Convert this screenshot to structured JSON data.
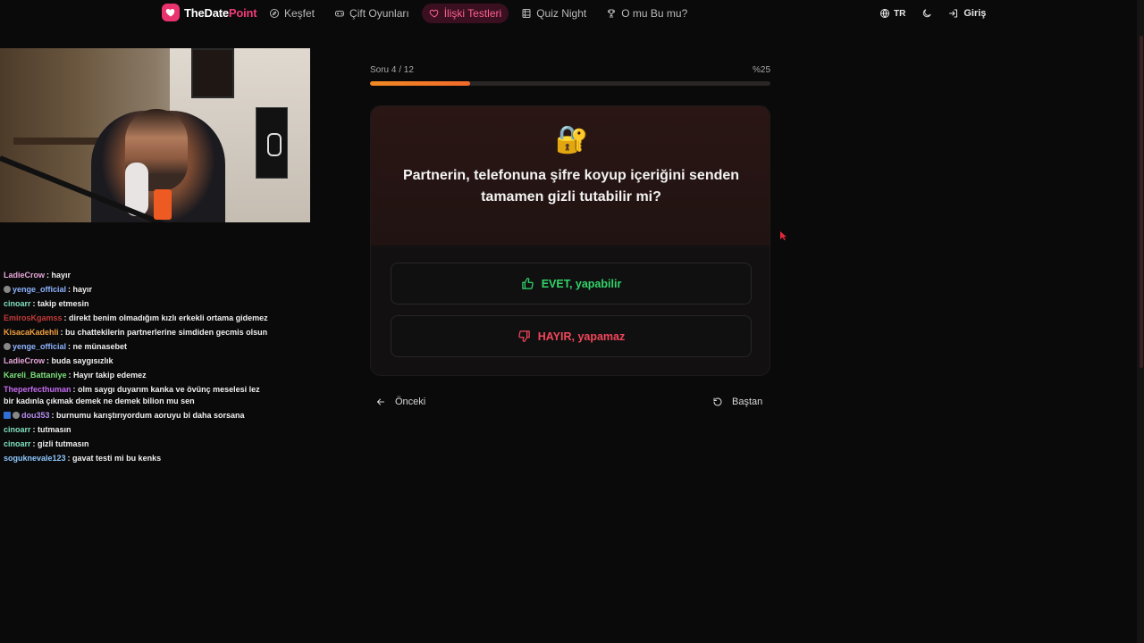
{
  "nav": {
    "brand_part1": "TheDate",
    "brand_part2": "Point",
    "links": [
      {
        "label": "Keşfet",
        "icon": "compass-icon"
      },
      {
        "label": "Çift Oyunları",
        "icon": "gamepad-icon"
      },
      {
        "label": "İlişki Testleri",
        "icon": "heart-icon",
        "active": true
      },
      {
        "label": "Quiz Night",
        "icon": "film-icon"
      },
      {
        "label": "O mu Bu mu?",
        "icon": "trophy-icon"
      }
    ],
    "language": "TR",
    "login": "Giriş"
  },
  "quiz": {
    "progress_label": "Soru 4 / 12",
    "progress_percent_label": "%25",
    "progress": 0.25,
    "question_icon": "lock-key-icon",
    "question": "Partnerin, telefonuna şifre koyup içeriğini senden tamamen gizli tutabilir mi?",
    "answer_yes": "EVET, yapabilir",
    "answer_no": "HAYIR, yapamaz",
    "prev_label": "Önceki",
    "restart_label": "Baştan"
  },
  "chat": [
    {
      "user": "LadieCrow",
      "color": "#e6a6d8",
      "text": ": hayır"
    },
    {
      "user": "yenge_official",
      "color": "#8cb4ff",
      "text": ": hayır",
      "badge": true
    },
    {
      "user": "cinoarr",
      "color": "#7fe0c0",
      "text": ": takip etmesin"
    },
    {
      "user": "EmirosKgamss",
      "color": "#c23a3a",
      "text": ": direkt benim olmadığım kızlı erkekli ortama gidemez"
    },
    {
      "user": "KisacaKadehli",
      "color": "#f0a040",
      "text": ": bu chattekilerin partnerlerine simdiden gecmis olsun"
    },
    {
      "user": "yenge_official",
      "color": "#8cb4ff",
      "text": ": ne münasebet",
      "badge": true
    },
    {
      "user": "LadieCrow",
      "color": "#e6a6d8",
      "text": ": buda saygısızlık"
    },
    {
      "user": "Kareli_Battaniye",
      "color": "#7be07b",
      "text": ": Hayır takip edemez"
    },
    {
      "user": "Theperfecthuman",
      "color": "#c46cf0",
      "text": ": olm saygı duyarım kanka ve övünç meselesi lez bir kadınla çıkmak demek ne demek bilion mu sen"
    },
    {
      "user": "dou353",
      "color": "#b48cf0",
      "text": ": burnumu karıştırıyordum aoruyu bi daha sorsana",
      "badge2": true
    },
    {
      "user": "cinoarr",
      "color": "#7fe0c0",
      "text": ": tutmasın"
    },
    {
      "user": "cinoarr",
      "color": "#7fe0c0",
      "text": ": gizli tutmasın"
    },
    {
      "user": "soguknevale123",
      "color": "#8cc8ff",
      "text": ": gavat testi mi bu kenks"
    }
  ],
  "colors": {
    "accent": "#ee3b78",
    "progress": "#f08a24",
    "yes": "#31d46a",
    "no": "#f0465a"
  }
}
